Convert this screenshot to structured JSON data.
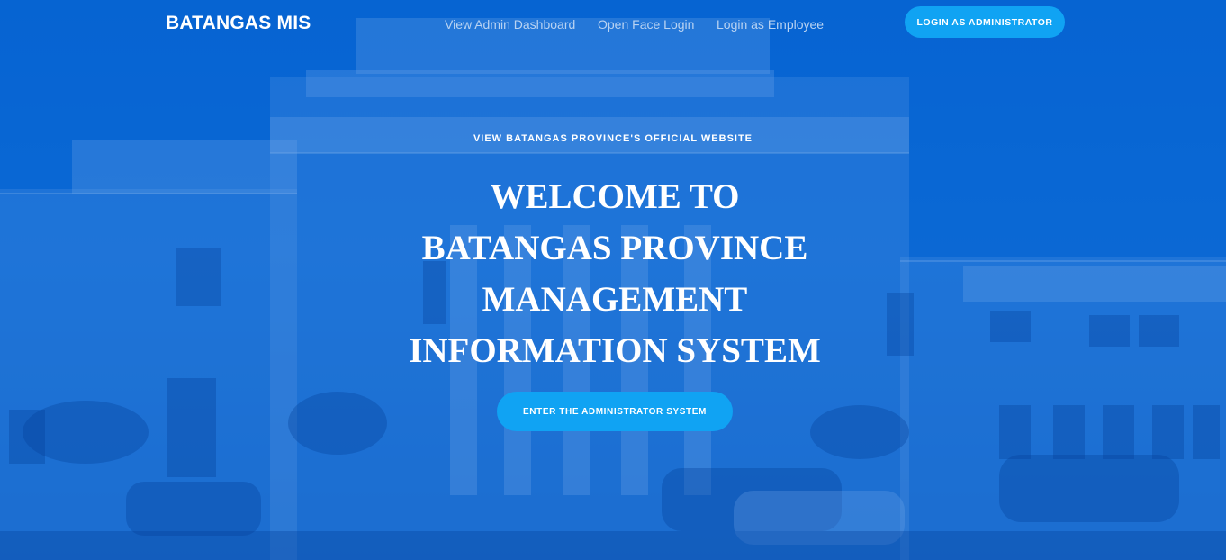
{
  "nav": {
    "brand": "BATANGAS MIS",
    "links": [
      {
        "label": "View Admin Dashboard"
      },
      {
        "label": "Open Face Login"
      },
      {
        "label": "Login as Employee"
      }
    ],
    "cta_label": "LOGIN AS ADMINISTRATOR"
  },
  "hero": {
    "official_link": "VIEW BATANGAS PROVINCE'S OFFICIAL WEBSITE",
    "headline_lines": [
      "WELCOME TO",
      "BATANGAS PROVINCE",
      "MANAGEMENT",
      "INFORMATION SYSTEM"
    ],
    "enter_button": "ENTER THE ADMINISTRATOR SYSTEM"
  },
  "theme": {
    "background": "#0a63c9",
    "accent": "#10a3f3",
    "nav_link_color": "#b9d3f2"
  },
  "icons": {
    "background": "capitol-building-photo"
  }
}
